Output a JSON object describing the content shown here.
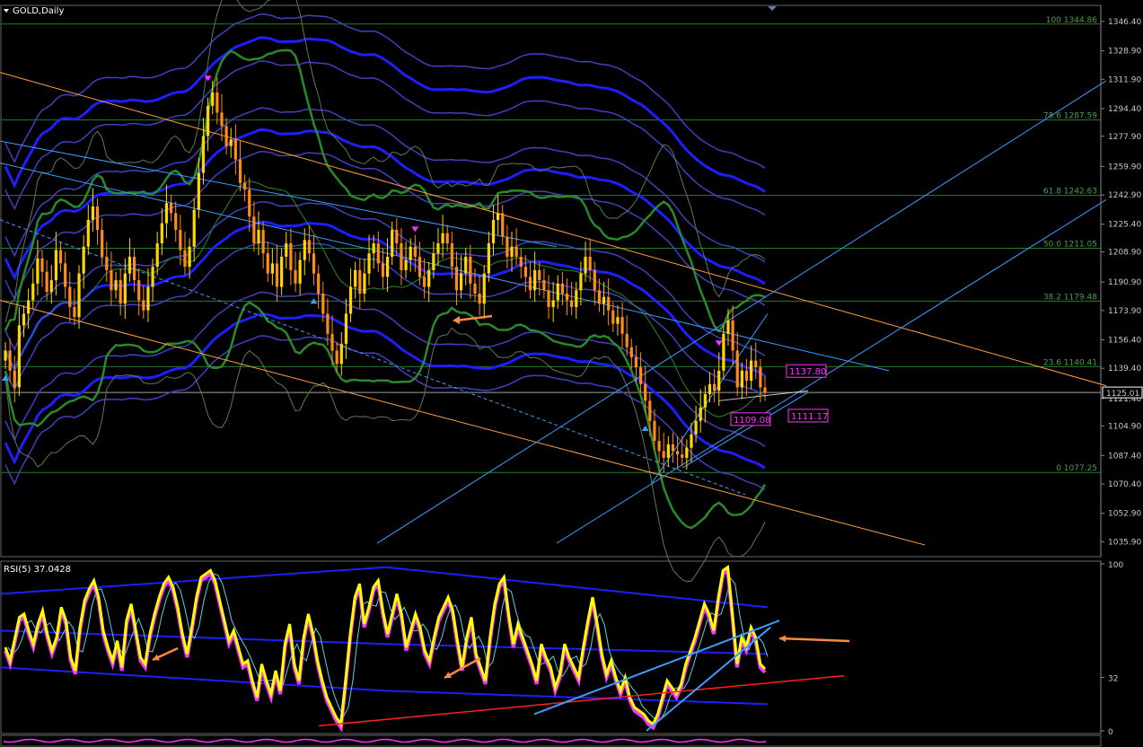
{
  "window": {
    "title": "GOLD,Daily",
    "rsi_label": "RSI(5) 37.0428"
  },
  "colors": {
    "background": "#000000",
    "bull_candle": "#ffd700",
    "bear_candle": "#ff8c1a",
    "ma_main": "#1e1eff",
    "ma_secondary": "#4040c0",
    "bollinger": "#2a8a2a",
    "channel_orange": "#ffa040",
    "channel_blue": "#3c9cff",
    "fib_green": "#2d7a2d",
    "rsi_main": "#ffff00",
    "rsi_outline": "#ff33ff",
    "rsi_trend": "#ff2020",
    "arrow_marker": "#ff8844",
    "box_magenta": "#ff33ff"
  },
  "chart_data": [
    {
      "type": "candlestick",
      "title": "GOLD,Daily",
      "y_axis": {
        "ticks": [
          "1346.40",
          "1328.90",
          "1311.90",
          "1294.40",
          "1277.90",
          "1259.90",
          "1242.90",
          "1225.40",
          "1208.90",
          "1190.90",
          "1173.90",
          "1156.40",
          "1139.40",
          "1121.40",
          "1104.90",
          "1087.40",
          "1070.40",
          "1052.90",
          "1035.90"
        ],
        "range": [
          1027,
          1356
        ]
      },
      "fib_levels": [
        {
          "label": "100 1344.86",
          "value": 1344.86
        },
        {
          "label": "78.6 1287.59",
          "value": 1287.59
        },
        {
          "label": "61.8 1242.63",
          "value": 1242.63
        },
        {
          "label": "50.0 1211.05",
          "value": 1211.05
        },
        {
          "label": "38.2 1179.48",
          "value": 1179.48
        },
        {
          "label": "23.6 1140.41",
          "value": 1140.41
        },
        {
          "label": "0 1077.25",
          "value": 1077.25
        }
      ],
      "current_price": {
        "label": "1125.01",
        "value": 1125.01
      },
      "price_boxes": [
        {
          "label": "1137.80",
          "value": 1137.8
        },
        {
          "label": "1109.08",
          "value": 1109.08
        },
        {
          "label": "1111.17",
          "value": 1111.17
        }
      ],
      "closes": [
        1150,
        1138,
        1128,
        1165,
        1172,
        1180,
        1190,
        1205,
        1197,
        1185,
        1192,
        1210,
        1202,
        1188,
        1176,
        1170,
        1196,
        1212,
        1228,
        1236,
        1222,
        1206,
        1198,
        1186,
        1192,
        1178,
        1196,
        1206,
        1192,
        1180,
        1174,
        1188,
        1200,
        1214,
        1226,
        1238,
        1232,
        1222,
        1210,
        1200,
        1212,
        1234,
        1256,
        1278,
        1296,
        1304,
        1292,
        1284,
        1272,
        1276,
        1264,
        1250,
        1246,
        1230,
        1214,
        1222,
        1208,
        1196,
        1202,
        1188,
        1206,
        1214,
        1198,
        1190,
        1204,
        1216,
        1208,
        1196,
        1184,
        1172,
        1160,
        1150,
        1142,
        1154,
        1172,
        1188,
        1198,
        1184,
        1196,
        1208,
        1214,
        1202,
        1194,
        1206,
        1222,
        1214,
        1198,
        1204,
        1212,
        1206,
        1194,
        1188,
        1198,
        1208,
        1214,
        1220,
        1214,
        1200,
        1186,
        1196,
        1206,
        1190,
        1184,
        1178,
        1196,
        1214,
        1228,
        1232,
        1218,
        1206,
        1212,
        1206,
        1200,
        1194,
        1186,
        1198,
        1192,
        1186,
        1176,
        1180,
        1190,
        1184,
        1180,
        1176,
        1186,
        1196,
        1206,
        1198,
        1186,
        1178,
        1182,
        1174,
        1166,
        1170,
        1160,
        1152,
        1146,
        1140,
        1130,
        1120,
        1108,
        1096,
        1090,
        1086,
        1094,
        1090,
        1088,
        1086,
        1092,
        1100,
        1108,
        1116,
        1124,
        1130,
        1126,
        1138,
        1160,
        1168,
        1150,
        1128,
        1138,
        1132,
        1144,
        1140,
        1128,
        1125
      ]
    },
    {
      "type": "line",
      "title": "RSI(5) 37.0428",
      "y_axis": {
        "ticks": [
          "100",
          "32",
          "0"
        ],
        "range": [
          0,
          100
        ]
      },
      "values": [
        50,
        42,
        55,
        68,
        70,
        60,
        52,
        64,
        72,
        58,
        48,
        56,
        74,
        66,
        44,
        36,
        62,
        78,
        85,
        90,
        80,
        60,
        50,
        42,
        54,
        38,
        66,
        76,
        60,
        44,
        40,
        58,
        70,
        80,
        88,
        92,
        86,
        74,
        58,
        46,
        62,
        80,
        92,
        94,
        96,
        90,
        78,
        66,
        54,
        60,
        50,
        40,
        42,
        30,
        20,
        40,
        30,
        22,
        36,
        24,
        52,
        64,
        40,
        30,
        56,
        70,
        58,
        42,
        30,
        20,
        14,
        8,
        4,
        30,
        58,
        80,
        88,
        64,
        74,
        86,
        90,
        72,
        58,
        70,
        82,
        70,
        50,
        60,
        70,
        62,
        48,
        42,
        56,
        68,
        74,
        80,
        72,
        54,
        38,
        56,
        68,
        46,
        38,
        30,
        56,
        76,
        88,
        92,
        70,
        52,
        64,
        56,
        48,
        40,
        30,
        52,
        44,
        38,
        26,
        34,
        52,
        44,
        38,
        32,
        50,
        66,
        80,
        64,
        46,
        34,
        42,
        32,
        24,
        32,
        20,
        14,
        12,
        10,
        6,
        4,
        10,
        20,
        30,
        26,
        22,
        28,
        40,
        48,
        56,
        66,
        76,
        70,
        60,
        80,
        96,
        98,
        70,
        40,
        56,
        50,
        62,
        56,
        40,
        37
      ]
    }
  ]
}
